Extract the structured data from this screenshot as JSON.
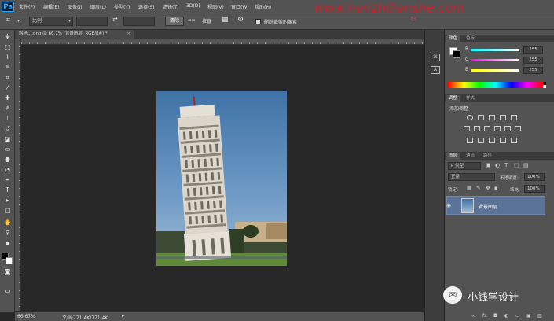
{
  "app": {
    "logo": "Ps"
  },
  "menu": [
    "文件(F)",
    "编辑(E)",
    "图像(I)",
    "图层(L)",
    "类型(Y)",
    "选择(S)",
    "滤镜(T)",
    "3D(D)",
    "视图(V)",
    "窗口(W)",
    "帮助(H)"
  ],
  "watermark": {
    "url": "www.hanzhilianshe.com"
  },
  "options": {
    "ratio": "比例",
    "clear_button": "清除",
    "straighten_label": "拉直",
    "delete_cropped_label": "删除裁剪的像素"
  },
  "document": {
    "tab_label": "斜塔....png @ 66.7% (背景图层, RGB/8#) *",
    "close": "×"
  },
  "status": {
    "zoom": "66.67%",
    "doc_size": "文档:771.4K/771.4K"
  },
  "color_panel": {
    "tabs": [
      "颜色",
      "色板"
    ],
    "channels": [
      {
        "label": "R",
        "value": "255"
      },
      {
        "label": "G",
        "value": "255"
      },
      {
        "label": "B",
        "value": "255"
      }
    ]
  },
  "adjust_panel": {
    "tabs": [
      "调整",
      "样式"
    ],
    "title": "添加调整"
  },
  "layers_panel": {
    "tabs": [
      "图层",
      "通道",
      "路径"
    ],
    "filter": "P 类型",
    "blend_mode": "正常",
    "opacity_label": "不透明度:",
    "opacity_value": "100%",
    "lock_label": "锁定:",
    "fill_label": "填充:",
    "fill_value": "100%",
    "layer_name": "背景图层"
  },
  "brand": {
    "name": "小钱学设计"
  },
  "colors": {
    "accent": "#31a8ff",
    "watermark": "#d0202a",
    "selection": "#5b7396"
  }
}
